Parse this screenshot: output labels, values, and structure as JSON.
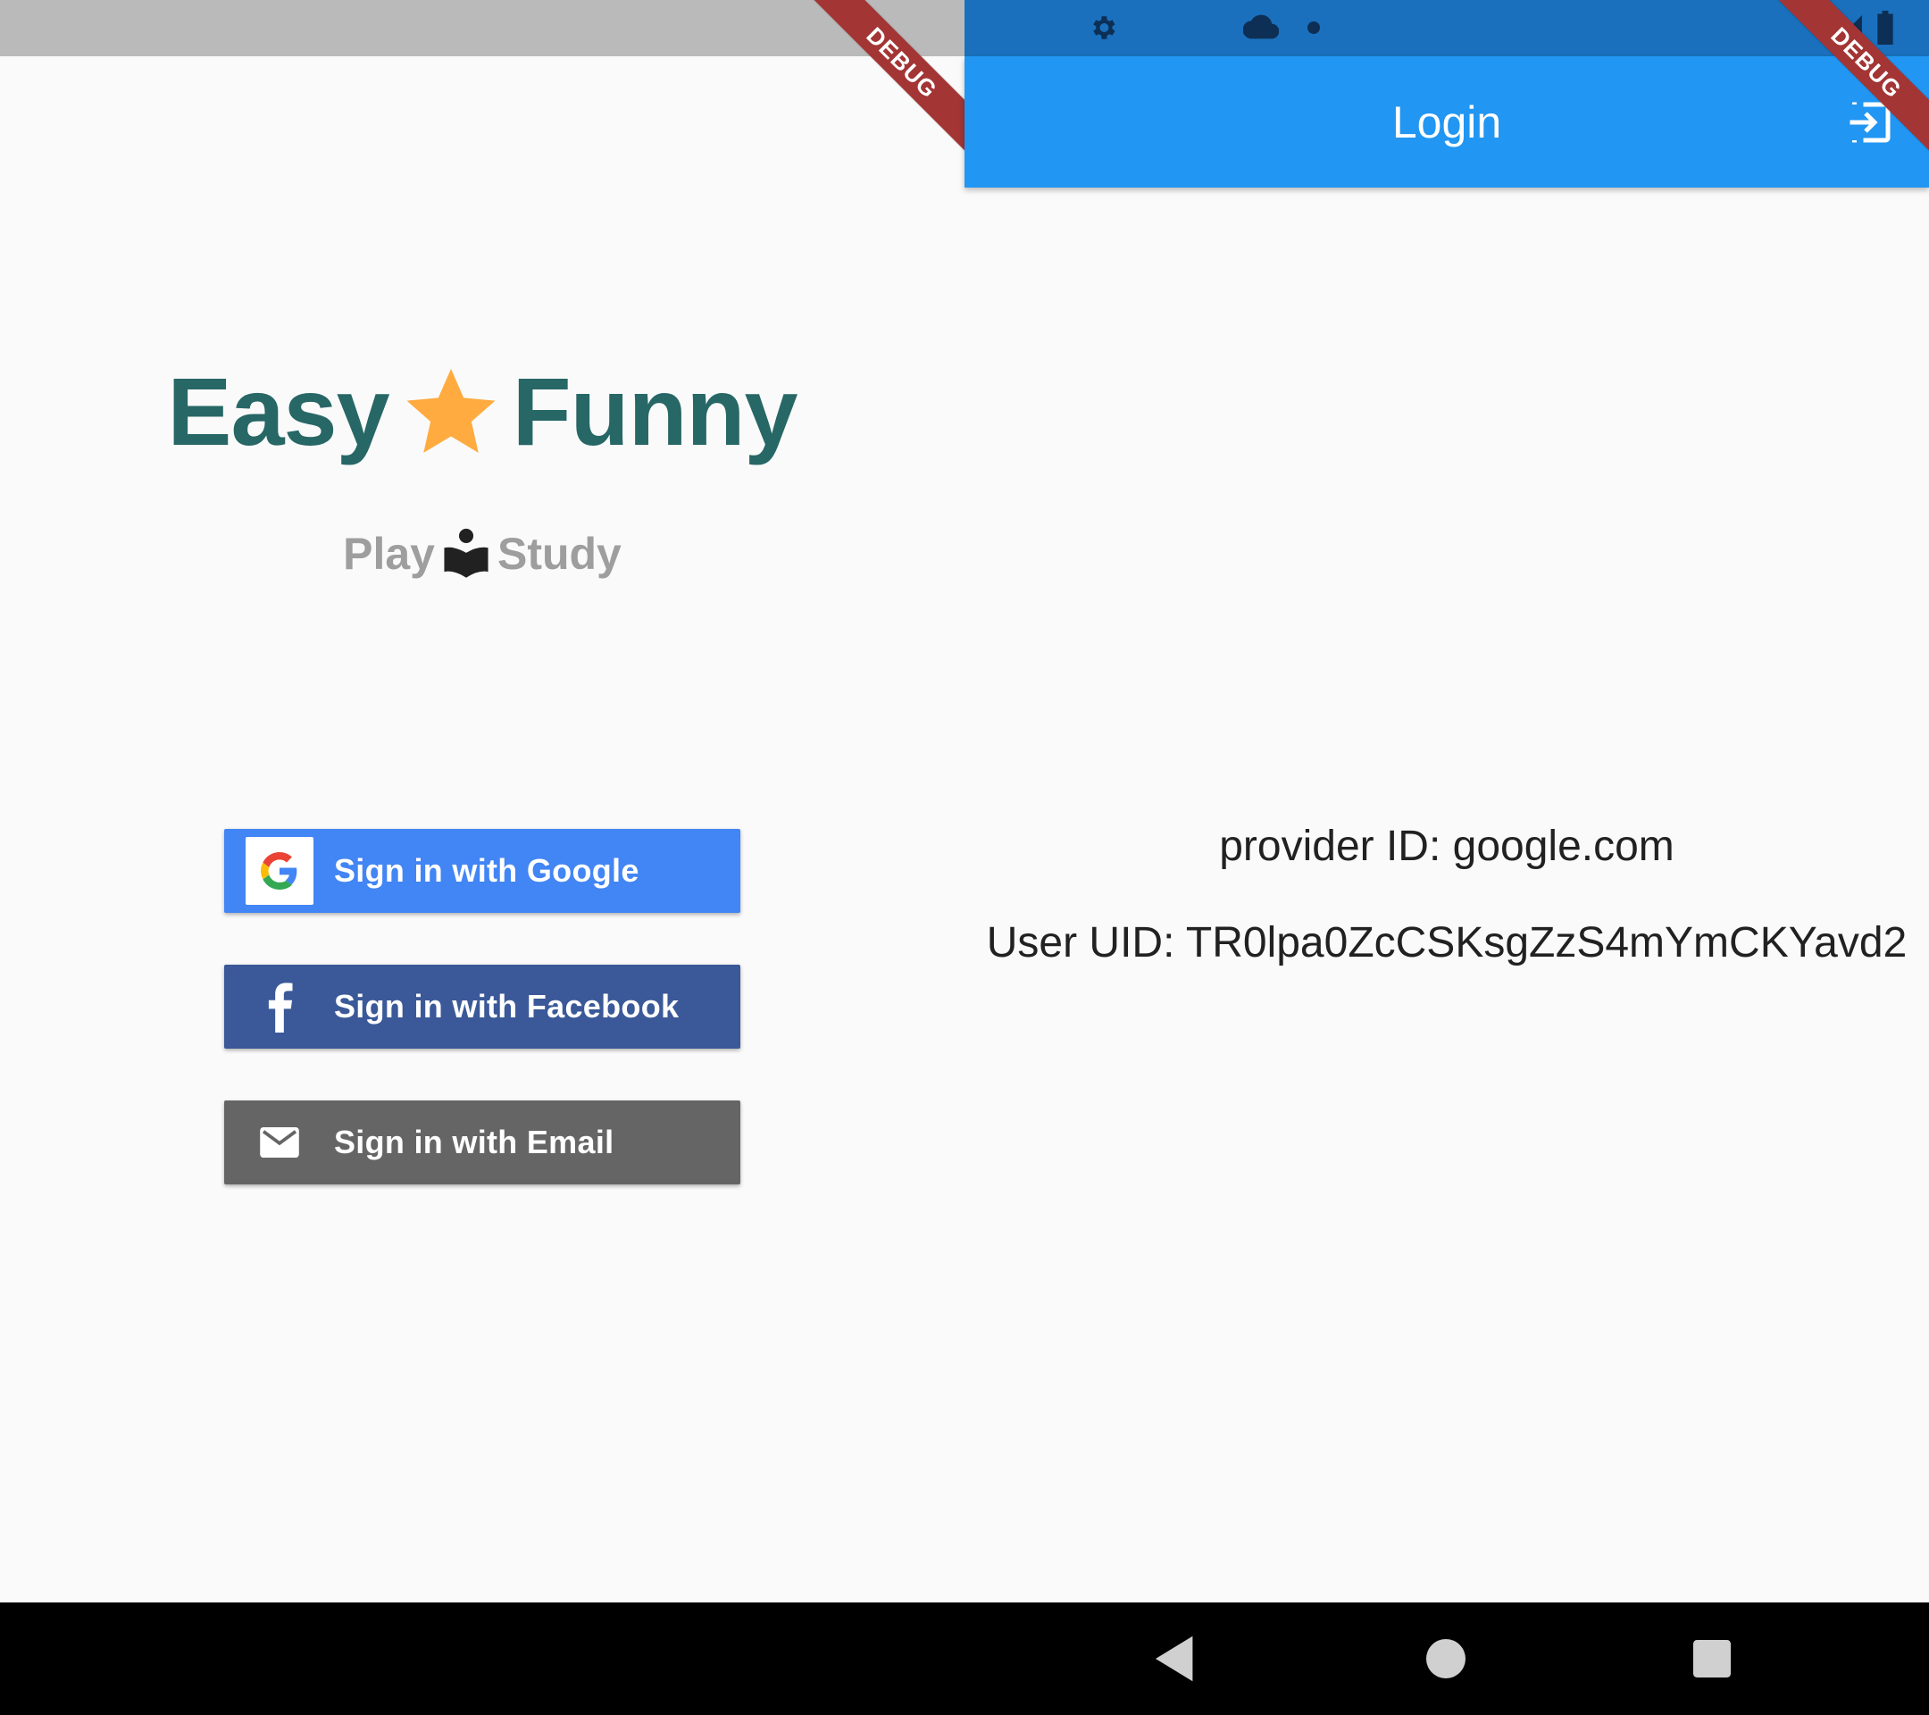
{
  "left_app": {
    "brand": {
      "word1": "Easy",
      "word2": "Funny",
      "star_color": "#ffab40",
      "text_color": "#276766"
    },
    "tagline": {
      "word1": "Play",
      "word2": "Study",
      "icon": "reader-icon"
    },
    "buttons": {
      "google_label": "Sign in with Google",
      "facebook_label": "Sign in with Facebook",
      "email_label": "Sign in with Email"
    },
    "debug_banner": "DEBUG"
  },
  "right_app": {
    "appbar": {
      "title": "Login",
      "action_icon": "login-icon"
    },
    "provider_text": "provider ID: google.com",
    "uid_text": "User UID: TR0lpa0ZcCSKsgZzS4mYmCKYavd2",
    "debug_banner": "DEBUG"
  },
  "status_bar": {
    "icons": [
      "gear-icon",
      "cloud-icon",
      "dot-icon",
      "signal-icon",
      "battery-icon"
    ]
  },
  "navbar": {
    "buttons": [
      "back-icon",
      "home-icon",
      "recents-icon"
    ]
  },
  "colors": {
    "google": "#4285f4",
    "facebook": "#3b5998",
    "email": "#656565",
    "appbar": "#2196f3",
    "status_right": "#1a70bd"
  }
}
